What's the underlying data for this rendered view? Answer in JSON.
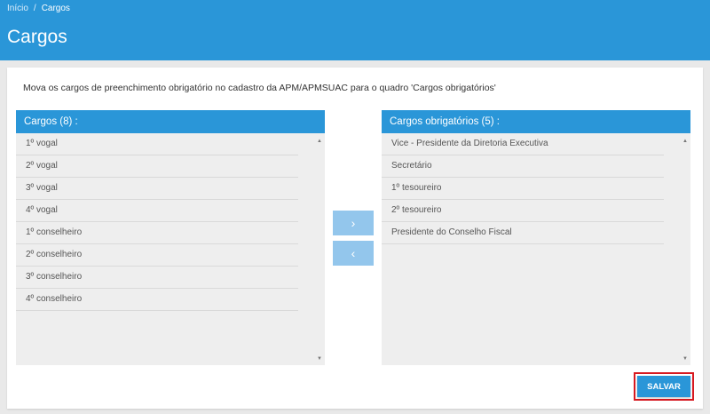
{
  "breadcrumb": {
    "home": "Início",
    "separator": "/",
    "current": "Cargos"
  },
  "page": {
    "title": "Cargos",
    "instruction": "Mova os cargos de preenchimento obrigatório no cadastro da APM/APMSUAC para o quadro 'Cargos obrigatórios'"
  },
  "available": {
    "header": "Cargos (8) :",
    "items": [
      "1º vogal",
      "2º vogal",
      "3º vogal",
      "4º vogal",
      "1º conselheiro",
      "2º conselheiro",
      "3º conselheiro",
      "4º conselheiro"
    ]
  },
  "required": {
    "header": "Cargos obrigatórios (5) :",
    "items": [
      "Vice - Presidente da Diretoria Executiva",
      "Secretário",
      "1º tesoureiro",
      "2º tesoureiro",
      "Presidente do Conselho Fiscal"
    ]
  },
  "controls": {
    "move_right_icon": "›",
    "move_left_icon": "‹",
    "scroll_up_icon": "▲",
    "scroll_down_icon": "▼",
    "save_label": "SALVAR"
  },
  "colors": {
    "primary": "#2a96d8",
    "button_light": "#93c6ec",
    "highlight_border": "#d71920"
  }
}
